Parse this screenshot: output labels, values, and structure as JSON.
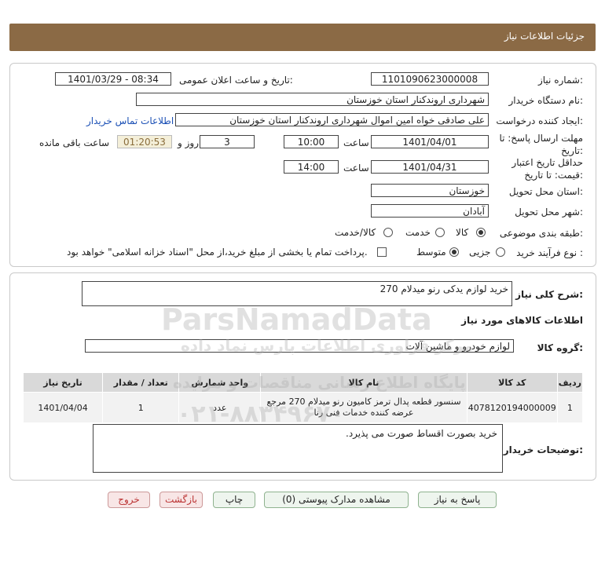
{
  "header": {
    "title": "جزئیات اطلاعات نیاز"
  },
  "info": {
    "need_number_label": "شماره نیاز:",
    "need_number": "1101090623000008",
    "announce_label": "تاریخ و ساعت اعلان عمومی:",
    "announce_value": "1401/03/29 - 08:34",
    "buyer_org_label": "نام دستگاه خریدار:",
    "buyer_org": "شهرداری اروندکنار استان خوزستان",
    "requester_label": "ایجاد کننده درخواست:",
    "requester": "علی صادقی خواه امین اموال شهرداری اروندکنار استان خوزستان",
    "contact_link": "اطلاعات تماس خریدار",
    "deadline_label": "مهلت ارسال پاسخ: تا تاریخ:",
    "deadline_date": "1401/04/01",
    "time_label": "ساعت",
    "deadline_time": "10:00",
    "days_value": "3",
    "days_label": "روز و",
    "remaining_time": "01:20:53",
    "remaining_label": "ساعت باقی مانده",
    "validity_label": "حداقل تاریخ اعتبار قیمت: تا تاریخ:",
    "validity_date": "1401/04/31",
    "validity_time": "14:00",
    "province_label": "استان محل تحویل:",
    "province": "خوزستان",
    "city_label": "شهر محل تحویل:",
    "city": "آبادان",
    "category_label": "طبقه بندی موضوعی:",
    "category_options": [
      "کالا",
      "خدمت",
      "کالا/خدمت"
    ],
    "process_label": "نوع فرآیند خرید :",
    "process_options": [
      "جزیی",
      "متوسط"
    ],
    "payment_note": "پرداخت تمام یا بخشی از مبلغ خرید،از محل \"اسناد خزانه اسلامی\" خواهد بود."
  },
  "summary": {
    "general_desc_label": "شرح کلی نیاز:",
    "general_desc": "خرید لوازم یدکی رنو میدلام 270",
    "goods_info_title": "اطلاعات کالاهای مورد نیاز",
    "goods_group_label": "گروه کالا:",
    "goods_group": "لوازم خودرو و ماشین آلات",
    "table_headers": [
      "ردیف",
      "کد کالا",
      "نام کالا",
      "واحد شمارش",
      "تعداد / مقدار",
      "تاریخ نیاز"
    ],
    "table_rows": [
      [
        "1",
        "4078120194000009",
        "سنسور قطعه پدال ترمز کامیون رنو میدلام 270 مرجع عرضه کننده خدمات فنی رنا",
        "عدد",
        "1",
        "1401/04/04"
      ]
    ],
    "buyer_notes_label": "توضیحات خریدار:",
    "buyer_notes": "خرید بصورت اقساط صورت می پذیرد."
  },
  "buttons": {
    "reply": "پاسخ به نیاز",
    "attachments": "مشاهده مدارک پیوستی (0)",
    "print": "چاپ",
    "back": "بازگشت",
    "exit": "خروج"
  },
  "watermark": {
    "brand": "ParsNamadData",
    "line1": "مرکز فراوری اطلاعات پارس نماد داده",
    "line2": "پایگاه اطلاع رسانی مناقصات و مزایده",
    "phone": "۰۲۱-۸۸۳۴۹۶۷۰"
  }
}
